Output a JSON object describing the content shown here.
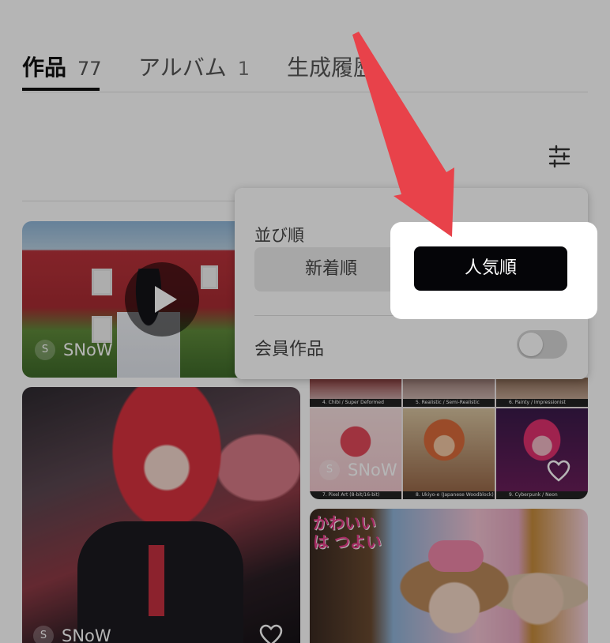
{
  "tabs": [
    {
      "label": "作品",
      "count": "77",
      "active": true
    },
    {
      "label": "アルバム",
      "count": "1",
      "active": false
    },
    {
      "label": "生成履歴",
      "active": false
    }
  ],
  "filter": {
    "icon": "sliders-icon"
  },
  "cards": [
    {
      "owner_initial": "S",
      "owner_name": "SNoW",
      "kind": "video"
    },
    {
      "owner_initial": "S",
      "owner_name": "SNoW"
    },
    {
      "owner_initial": "S",
      "owner_name": "SNoW"
    },
    {
      "sticker": "かわいいは つよい"
    }
  ],
  "style_grid": {
    "captions": [
      "4. Chibi / Super Deformed",
      "5. Realistic / Semi-Realistic",
      "6. Painty / Impressionist",
      "7. Pixel Art (8-bit/16-bit)",
      "8. Ukiyo-e (Japanese Woodblock)",
      "9. Cyberpunk / Neon"
    ]
  },
  "popover": {
    "sort_label": "並び順",
    "sort_options": [
      {
        "label": "新着順",
        "selected": false
      },
      {
        "label": "人気順",
        "selected": true
      }
    ],
    "members_label": "会員作品",
    "members_toggle_on": false
  },
  "colors": {
    "accent_arrow": "#e8424a",
    "selected_button": "#050508",
    "overlay": "rgba(0,0,0,0.29)"
  }
}
